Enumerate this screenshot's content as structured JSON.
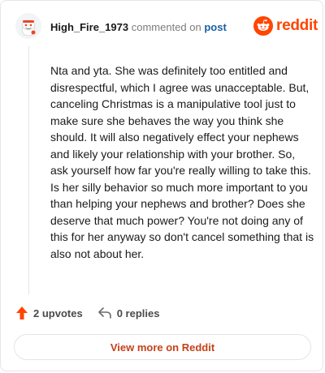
{
  "header": {
    "username": "High_Fire_1973",
    "commented_text": "commented on",
    "post_link": "post"
  },
  "brand": {
    "wordmark": "reddit",
    "icon": "reddit-alien-icon",
    "color": "#ff4500"
  },
  "comment": {
    "body": "Nta and yta. She was definitely too entitled and disrespectful, which I agree was unacceptable. But, canceling Christmas is a manipulative tool just to make sure she behaves the way you think she should. It will also negatively effect your nephews and likely your relationship with your brother. So, ask yourself how far you're really willing to take this. Is her silly behavior so much more important to you than helping your nephews and brother? Does she deserve that much power? You're not doing any of this for her anyway so don't cancel something that is also not about her."
  },
  "actions": {
    "upvotes_label": "2 upvotes",
    "upvote_icon": "upvote-arrow-icon",
    "upvote_color": "#ff4500",
    "replies_label": "0 replies",
    "reply_icon": "reply-arrow-icon"
  },
  "footer": {
    "view_more_label": "View more on Reddit",
    "accent": "#c4421a"
  }
}
